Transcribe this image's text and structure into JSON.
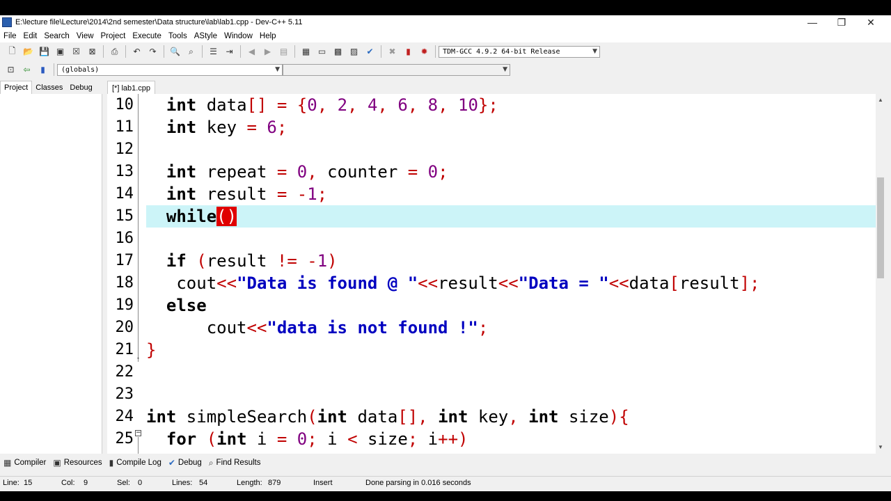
{
  "window": {
    "title": "E:\\lecture file\\Lecture\\2014\\2nd semester\\Data structure\\lab\\lab1.cpp - Dev-C++ 5.11",
    "controls": {
      "minimize": "—",
      "restore": "❐",
      "close": "✕"
    }
  },
  "menu": [
    "File",
    "Edit",
    "Search",
    "View",
    "Project",
    "Execute",
    "Tools",
    "AStyle",
    "Window",
    "Help"
  ],
  "toolbar": {
    "compiler_select": "TDM-GCC 4.9.2 64-bit Release",
    "scope_select": "(globals)",
    "function_select": ""
  },
  "left_tabs": [
    "Project",
    "Classes",
    "Debug"
  ],
  "editor_tab": "[*] lab1.cpp",
  "editor": {
    "line_numbers": [
      "10",
      "11",
      "12",
      "13",
      "14",
      "15",
      "16",
      "17",
      "18",
      "19",
      "20",
      "21",
      "22",
      "23",
      "24",
      "25"
    ],
    "fold_markers": {
      "close": "-",
      "open": "−"
    }
  },
  "bottom_tabs": [
    "Compiler",
    "Resources",
    "Compile Log",
    "Debug",
    "Find Results"
  ],
  "status": {
    "line_label": "Line:",
    "line": "15",
    "col_label": "Col:",
    "col": "9",
    "sel_label": "Sel:",
    "sel": "0",
    "lines_label": "Lines:",
    "lines": "54",
    "length_label": "Length:",
    "length": "879",
    "mode": "Insert",
    "message": "Done parsing in 0.016 seconds"
  },
  "colors": {
    "current_line": "#ccf4f8",
    "operator": "#c00000",
    "number": "#800080",
    "string": "#0000c0",
    "error_highlight": "#e00000"
  }
}
